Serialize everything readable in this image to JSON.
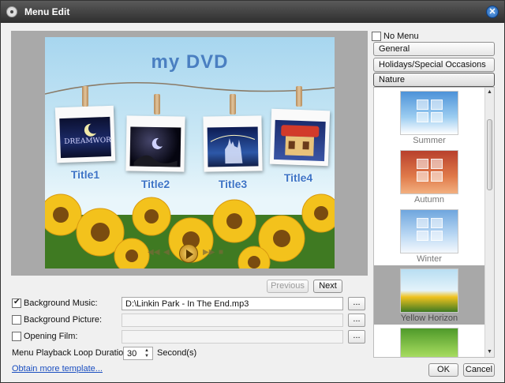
{
  "window": {
    "title": "Menu Edit"
  },
  "preview": {
    "dvd_title": "my DVD",
    "titles": [
      "Title1",
      "Title2",
      "Title3",
      "Title4"
    ]
  },
  "nav": {
    "previous": "Previous",
    "next": "Next"
  },
  "options": {
    "background_music": {
      "label": "Background Music:",
      "checked": true,
      "value": "D:\\Linkin Park - In The End.mp3"
    },
    "background_picture": {
      "label": "Background Picture:",
      "checked": false,
      "value": ""
    },
    "opening_film": {
      "label": "Opening Film:",
      "checked": false,
      "value": ""
    },
    "browse_label": "...",
    "loop": {
      "label": "Menu Playback Loop Duration:",
      "value": "30",
      "unit": "Second(s)"
    },
    "more_link": "Obtain more template..."
  },
  "sidebar": {
    "no_menu": {
      "label": "No Menu",
      "checked": false
    },
    "categories": [
      "General",
      "Holidays/Special Occasions",
      "Nature"
    ],
    "active_category": "Nature",
    "templates": [
      {
        "name": "Summer",
        "selected": false
      },
      {
        "name": "Autumn",
        "selected": false
      },
      {
        "name": "Winter",
        "selected": false
      },
      {
        "name": "Yellow Horizon",
        "selected": true
      },
      {
        "name": "",
        "selected": false
      }
    ]
  },
  "footer": {
    "ok": "OK",
    "cancel": "Cancel"
  },
  "colors": {
    "title_blue": "#3d74c6",
    "link_blue": "#1a4ec0",
    "selected_bg": "#a8a8a8"
  }
}
